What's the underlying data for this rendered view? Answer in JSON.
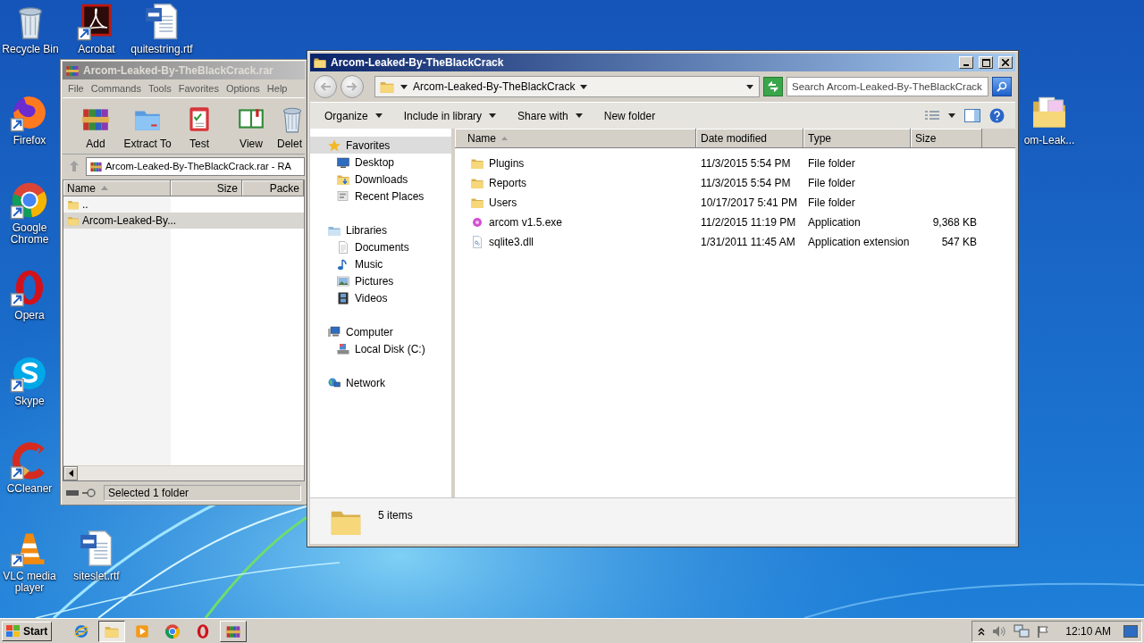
{
  "desktop_icons": [
    {
      "label": "Recycle Bin",
      "kind": "trash",
      "shortcut": false
    },
    {
      "label": "Acrobat",
      "kind": "acrobat",
      "shortcut": true
    },
    {
      "label": "quitestring.rtf",
      "kind": "word",
      "shortcut": false
    },
    {
      "label": "Firefox",
      "kind": "firefox",
      "shortcut": true
    },
    {
      "label": "Google Chrome",
      "kind": "chrome",
      "shortcut": true
    },
    {
      "label": "Opera",
      "kind": "opera",
      "shortcut": true
    },
    {
      "label": "Skype",
      "kind": "skype",
      "shortcut": true
    },
    {
      "label": "CCleaner",
      "kind": "ccleaner",
      "shortcut": true
    },
    {
      "label": "VLC media player",
      "kind": "vlc",
      "shortcut": true
    },
    {
      "label": "siteslet.rtf",
      "kind": "word",
      "shortcut": false
    },
    {
      "label": "om-Leak...",
      "kind": "folder-pics",
      "shortcut": false
    }
  ],
  "archive_window": {
    "title": "Arcom-Leaked-By-TheBlackCrack.rar",
    "menu": [
      "File",
      "Commands",
      "Tools",
      "Favorites",
      "Options",
      "Help"
    ],
    "toolbar": [
      {
        "label": "Add",
        "kind": "add"
      },
      {
        "label": "Extract To",
        "kind": "extract"
      },
      {
        "label": "Test",
        "kind": "test"
      },
      {
        "label": "View",
        "kind": "view"
      },
      {
        "label": "Delet",
        "kind": "delete"
      }
    ],
    "address": "Arcom-Leaked-By-TheBlackCrack.rar - RA",
    "columns": [
      "Name",
      "Size",
      "Packe"
    ],
    "rows": [
      {
        "name": "..",
        "selected": false
      },
      {
        "name": "Arcom-Leaked-By...",
        "selected": true
      }
    ],
    "status": "Selected 1 folder"
  },
  "explorer": {
    "title": "Arcom-Leaked-By-TheBlackCrack",
    "breadcrumb": "Arcom-Leaked-By-TheBlackCrack",
    "search_placeholder": "Search Arcom-Leaked-By-TheBlackCrack",
    "commands": [
      {
        "label": "Organize",
        "dropdown": true
      },
      {
        "label": "Include in library",
        "dropdown": true
      },
      {
        "label": "Share with",
        "dropdown": true
      },
      {
        "label": "New folder",
        "dropdown": false
      }
    ],
    "nav": [
      {
        "label": "Favorites",
        "kind": "star",
        "selected": true,
        "children": [
          {
            "label": "Desktop",
            "kind": "desktop",
            "selected": false
          },
          {
            "label": "Downloads",
            "kind": "downloads",
            "selected": false
          },
          {
            "label": "Recent Places",
            "kind": "recent",
            "selected": false
          }
        ]
      },
      {
        "label": "Libraries",
        "kind": "libraries",
        "selected": false,
        "children": [
          {
            "label": "Documents",
            "kind": "documents",
            "selected": false
          },
          {
            "label": "Music",
            "kind": "music",
            "selected": false
          },
          {
            "label": "Pictures",
            "kind": "pictures",
            "selected": false
          },
          {
            "label": "Videos",
            "kind": "videos",
            "selected": false
          }
        ]
      },
      {
        "label": "Computer",
        "kind": "computer",
        "selected": false,
        "children": [
          {
            "label": "Local Disk (C:)",
            "kind": "disk",
            "selected": false
          }
        ]
      },
      {
        "label": "Network",
        "kind": "network",
        "selected": false
      }
    ],
    "columns": [
      "Name",
      "Date modified",
      "Type",
      "Size"
    ],
    "files": [
      {
        "name": "Plugins",
        "date": "11/3/2015 5:54 PM",
        "type": "File folder",
        "kind": "folder"
      },
      {
        "name": "Reports",
        "date": "11/3/2015 5:54 PM",
        "type": "File folder",
        "kind": "folder"
      },
      {
        "name": "Users",
        "date": "10/17/2017 5:41 PM",
        "type": "File folder",
        "kind": "folder"
      },
      {
        "name": "arcom v1.5.exe",
        "date": "11/2/2015 11:19 PM",
        "type": "Application",
        "size": "9,368 KB",
        "kind": "exe"
      },
      {
        "name": "sqlite3.dll",
        "date": "1/31/2011 11:45 AM",
        "type": "Application extension",
        "size": "547 KB",
        "kind": "dll"
      }
    ],
    "status": "5 items"
  },
  "taskbar": {
    "start": "Start",
    "apps": [
      {
        "kind": "ie",
        "selected": false,
        "running": false
      },
      {
        "kind": "explorer",
        "selected": true,
        "running": true
      },
      {
        "kind": "media",
        "selected": false,
        "running": false
      },
      {
        "kind": "chrome",
        "selected": false,
        "running": false
      },
      {
        "kind": "opera",
        "selected": false,
        "running": false
      },
      {
        "kind": "winrar",
        "selected": false,
        "running": true
      }
    ],
    "clock": "12:10 AM"
  }
}
